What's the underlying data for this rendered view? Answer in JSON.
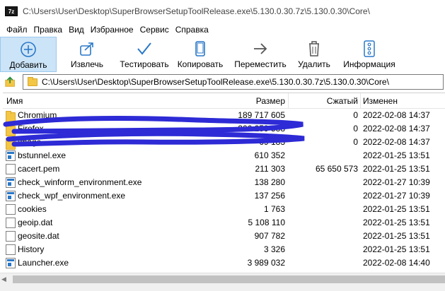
{
  "window": {
    "app_icon_text": "7z",
    "title": "C:\\Users\\User\\Desktop\\SuperBrowserSetupToolRelease.exe\\5.130.0.30.7z\\5.130.0.30\\Core\\"
  },
  "menu": [
    "Файл",
    "Правка",
    "Вид",
    "Избранное",
    "Сервис",
    "Справка"
  ],
  "toolbar": {
    "add": "Добавить",
    "extract": "Извлечь",
    "test": "Тестировать",
    "copy": "Копировать",
    "move": "Переместить",
    "delete": "Удалить",
    "info": "Информация"
  },
  "address": {
    "path": "C:\\Users\\User\\Desktop\\SuperBrowserSetupToolRelease.exe\\5.130.0.30.7z\\5.130.0.30\\Core\\"
  },
  "columns": {
    "name": "Имя",
    "size": "Размер",
    "packed": "Сжатый",
    "modified": "Изменен"
  },
  "files": [
    {
      "name": "Chromium",
      "type": "folder",
      "size": "189 717 605",
      "packed": "0",
      "modified": "2022-02-08 14:37"
    },
    {
      "name": "Firefox",
      "type": "folder",
      "size": "206 259 538",
      "packed": "0",
      "modified": "2022-02-08 14:37"
    },
    {
      "name": "Image",
      "type": "folder",
      "size": "69 183",
      "packed": "0",
      "modified": "2022-02-08 14:37"
    },
    {
      "name": "bstunnel.exe",
      "type": "exe",
      "size": "610 352",
      "packed": "",
      "modified": "2022-01-25 13:51"
    },
    {
      "name": "cacert.pem",
      "type": "file",
      "size": "211 303",
      "packed": "65 650 573",
      "modified": "2022-01-25 13:51"
    },
    {
      "name": "check_winform_environment.exe",
      "type": "exe",
      "size": "138 280",
      "packed": "",
      "modified": "2022-01-27 10:39"
    },
    {
      "name": "check_wpf_environment.exe",
      "type": "exe",
      "size": "137 256",
      "packed": "",
      "modified": "2022-01-27 10:39"
    },
    {
      "name": "cookies",
      "type": "file",
      "size": "1 763",
      "packed": "",
      "modified": "2022-01-25 13:51"
    },
    {
      "name": "geoip.dat",
      "type": "file",
      "size": "5 108 110",
      "packed": "",
      "modified": "2022-01-25 13:51"
    },
    {
      "name": "geosite.dat",
      "type": "file",
      "size": "907 782",
      "packed": "",
      "modified": "2022-01-25 13:51"
    },
    {
      "name": "History",
      "type": "file",
      "size": "3 326",
      "packed": "",
      "modified": "2022-01-25 13:51"
    },
    {
      "name": "Launcher.exe",
      "type": "exe",
      "size": "3 989 032",
      "packed": "",
      "modified": "2022-02-08 14:40"
    }
  ],
  "colors": {
    "scribble": "#2d2ad6",
    "toolbar_icon": "#2a78c8",
    "active_tool_bg": "#cce4f7"
  }
}
